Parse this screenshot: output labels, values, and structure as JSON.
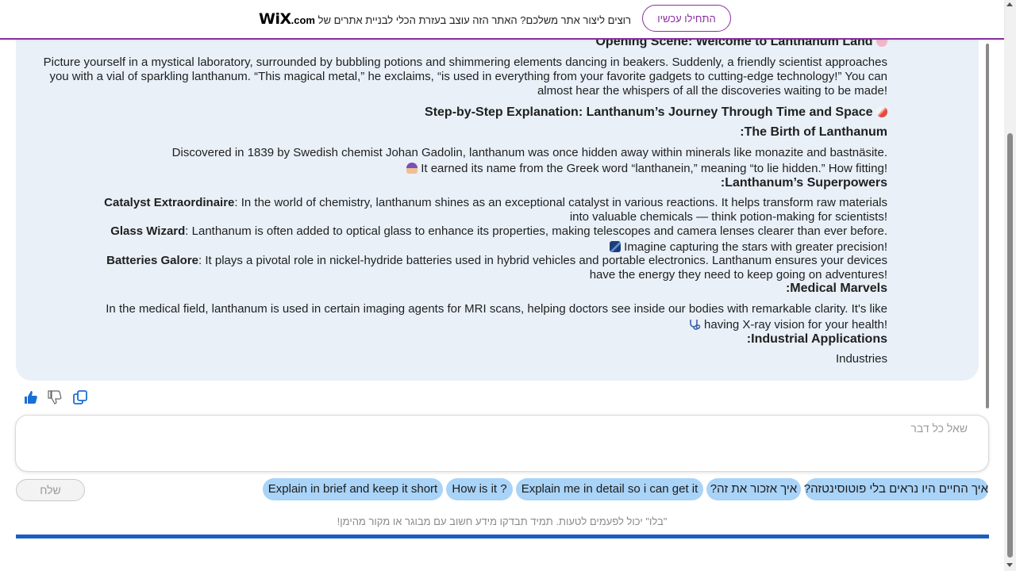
{
  "banner": {
    "text_prefix": "רוצים ליצור אתר משלכם? האתר הזה עוצב בעזרת הכלי לבניית אתרים של",
    "wix_logo": "WiX",
    "wix_com": ".com",
    "cta": "התחילו עכשיו",
    "accent_color": "#8b2fa0"
  },
  "message": {
    "opening_heading": "Opening Scene: Welcome to Lanthanum Land",
    "opening_text_1": "Picture yourself in a mystical laboratory, surrounded by bubbling potions and shimmering elements dancing in beakers. Suddenly, a friendly scientist approaches",
    "opening_text_2": "you with a vial of sparkling lanthanum. “This magical metal,” he exclaims, “is used in everything from your favorite gadgets to cutting-edge technology!” You can",
    "opening_text_3": "almost hear the whispers of all the discoveries waiting to be made!",
    "step_heading": "Step-by-Step Explanation: Lanthanum’s Journey Through Time and Space",
    "birth_heading": "The Birth of Lanthanum:",
    "birth_text_1": "Discovered in 1839 by Swedish chemist Johan Gadolin, lanthanum was once hidden away within minerals like monazite and bastnäsite.",
    "birth_text_2": "It earned its name from the Greek word “lanthanein,” meaning “to lie hidden.” How fitting!",
    "superpowers_heading": "Lanthanum’s Superpowers:",
    "catalyst_label": "Catalyst Extraordinaire",
    "catalyst_text_1": ": In the world of chemistry, lanthanum shines as an exceptional catalyst in various reactions. It helps transform raw materials",
    "catalyst_text_2": "into valuable chemicals — think potion-making for scientists!",
    "glass_label": "Glass Wizard",
    "glass_text_1": ": Lanthanum is often added to optical glass to enhance its properties, making telescopes and camera lenses clearer than ever before.",
    "glass_text_2": "Imagine capturing the stars with greater precision!",
    "batteries_label": "Batteries Galore",
    "batteries_text_1": ": It plays a pivotal role in nickel-hydride batteries used in hybrid vehicles and portable electronics. Lanthanum ensures your devices",
    "batteries_text_2": "have the energy they need to keep going on adventures!",
    "medical_heading": "Medical Marvels:",
    "medical_text_1": "In the medical field, lanthanum is used in certain imaging agents for MRI scans, helping doctors see inside our bodies with remarkable clarity. It's like",
    "medical_text_2": "having X-ray vision for your health!",
    "industrial_heading": "Industrial Applications:",
    "industrial_text": "Industries"
  },
  "input": {
    "placeholder": "שאל כל דבר"
  },
  "send_label": "שלח",
  "chips": [
    "איך החיים היו נראים בלי פוטוסינטזה?",
    "איך אזכור את זה?",
    "Explain me in detail so i can get it",
    "How is it ?",
    "Explain in brief and keep it short"
  ],
  "disclaimer": "\"בלו\" יכול לפעמים לטעות. תמיד תבדקו מידע חשוב עם מבוגר או מקור מהימן!",
  "colors": {
    "bubble_bg": "#e9f0f8",
    "chip_bg": "#a9d3f7",
    "bottom_bar": "#1a5fbf",
    "icon_blue": "#1a6fd6"
  },
  "icons": [
    "thumbs-up-icon",
    "thumbs-down-icon",
    "copy-icon",
    "rocket-icon",
    "mage-icon",
    "telescope-icon",
    "stethoscope-icon"
  ]
}
